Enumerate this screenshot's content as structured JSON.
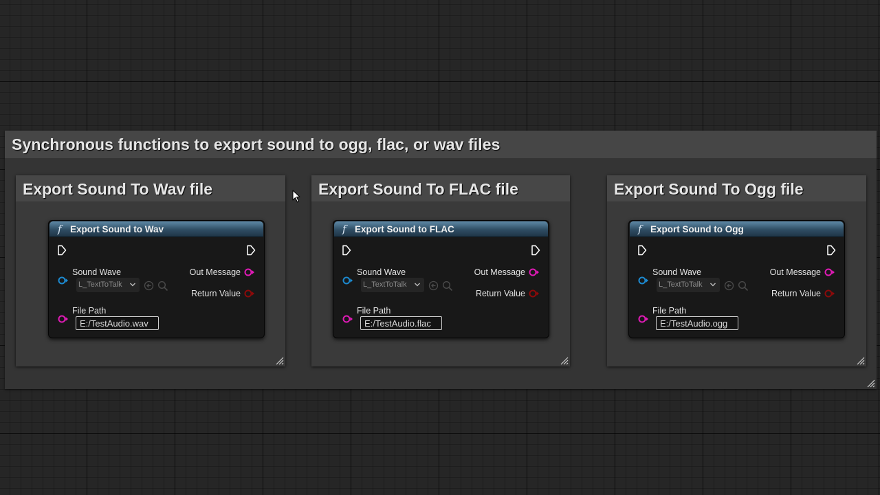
{
  "outer_comment": {
    "title": "Synchronous functions to export sound to ogg, flac, or wav files"
  },
  "groups": [
    {
      "comment_title": "Export Sound To Wav file",
      "node": {
        "title": "Export Sound to Wav",
        "sound_wave_label": "Sound Wave",
        "sound_wave_value": "L_TextToTalk",
        "file_path_label": "File Path",
        "file_path_value": "E:/TestAudio.wav",
        "out_message_label": "Out Message",
        "return_value_label": "Return Value"
      }
    },
    {
      "comment_title": "Export Sound To FLAC file",
      "node": {
        "title": "Export Sound to FLAC",
        "sound_wave_label": "Sound Wave",
        "sound_wave_value": "L_TextToTalk",
        "file_path_label": "File Path",
        "file_path_value": "E:/TestAudio.flac",
        "out_message_label": "Out Message",
        "return_value_label": "Return Value"
      }
    },
    {
      "comment_title": "Export Sound To Ogg file",
      "node": {
        "title": "Export Sound to Ogg",
        "sound_wave_label": "Sound Wave",
        "sound_wave_value": "L_TextToTalk",
        "file_path_label": "File Path",
        "file_path_value": "E:/TestAudio.ogg",
        "out_message_label": "Out Message",
        "return_value_label": "Return Value"
      }
    }
  ],
  "icons": {
    "function": "function-icon",
    "exec": "exec-pin-icon",
    "object_pin": "object-pin-icon",
    "string_pin": "string-pin-icon",
    "bool_pin": "bool-pin-icon",
    "browse": "browse-icon",
    "search": "search-icon"
  },
  "colors": {
    "object_pin": "#1c8ad0",
    "string_pin": "#e01ab6",
    "bool_pin": "#8c0a0a",
    "node_header": "#3d6a89"
  }
}
